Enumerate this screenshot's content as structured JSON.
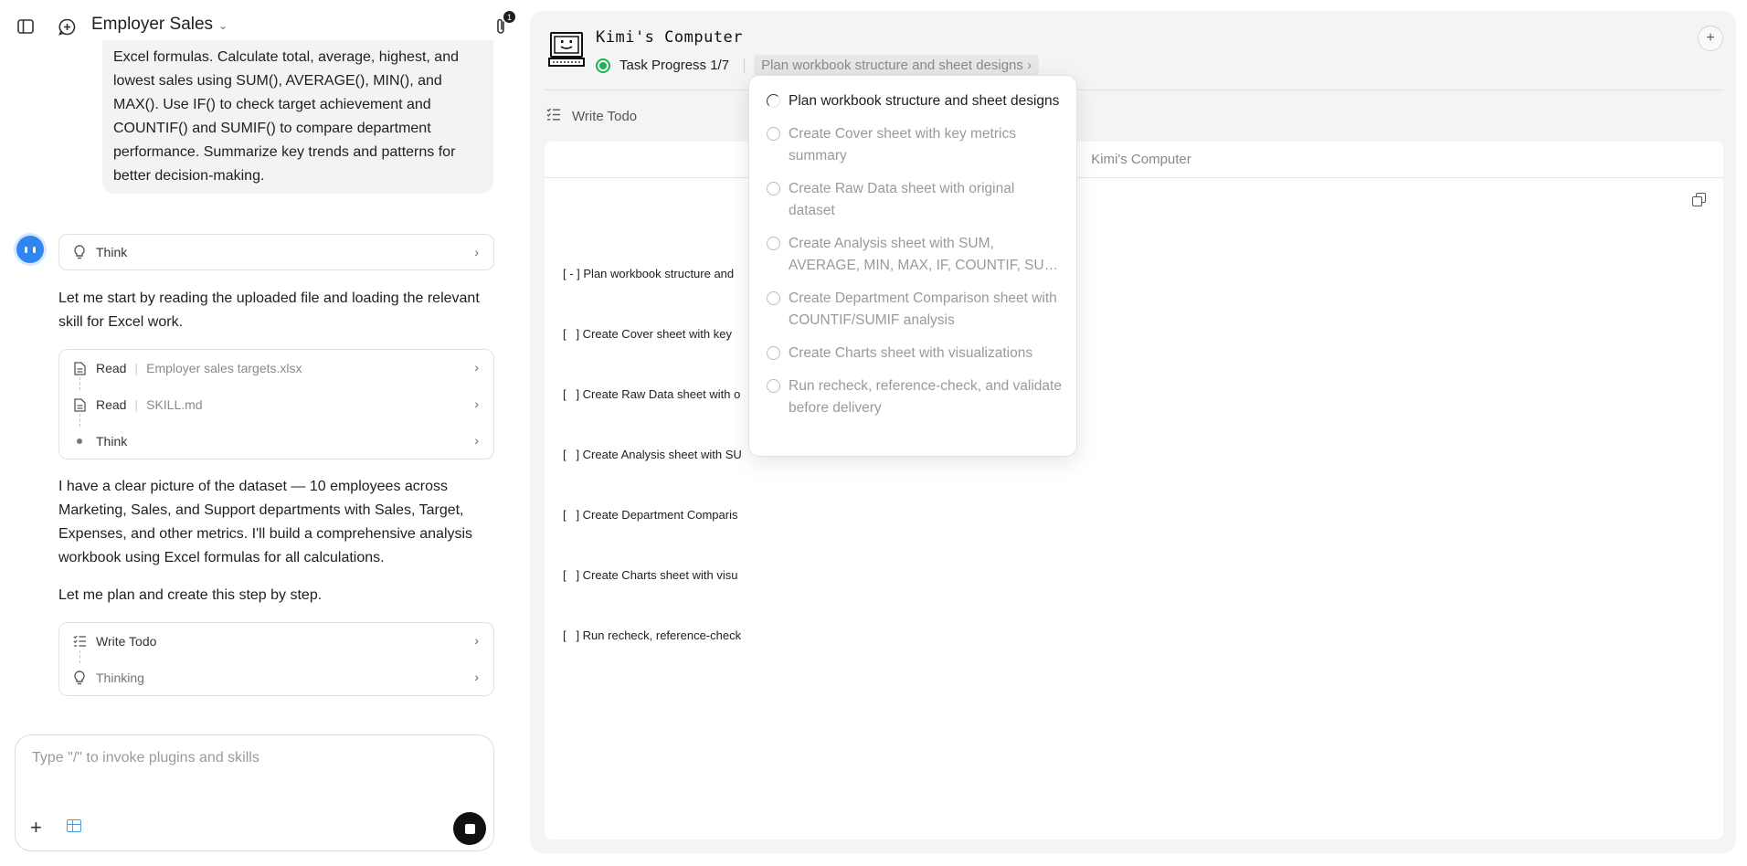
{
  "header": {
    "title": "Employer Sales",
    "attachment_count": "1"
  },
  "chat": {
    "user_message": "Excel formulas. Calculate total, average, highest, and lowest sales using SUM(), AVERAGE(), MIN(), and MAX(). Use IF() to check target achievement and COUNTIF() and SUMIF() to compare department performance. Summarize key trends and patterns for better decision-making.",
    "think_label": "Think",
    "msg1": "Let me start by reading the uploaded file and loading the relevant skill for Excel work.",
    "tool_group1": [
      {
        "name": "Read",
        "arg": "Employer sales targets.xlsx"
      },
      {
        "name": "Read",
        "arg": "SKILL.md"
      },
      {
        "name": "Think",
        "arg": ""
      }
    ],
    "msg2": "I have a clear picture of the dataset — 10 employees across Marketing, Sales, and Support departments with Sales, Target, Expenses, and other metrics. I'll build a comprehensive analysis workbook using Excel formulas for all calculations.",
    "msg3": "Let me plan and create this step by step.",
    "tool_group2": [
      {
        "name": "Write Todo"
      },
      {
        "name": "Thinking"
      }
    ]
  },
  "composer": {
    "placeholder": "Type \"/\" to invoke plugins and skills"
  },
  "computer": {
    "title": "Kimi's Computer",
    "progress_label": "Task Progress 1/7",
    "current_step": "Plan workbook structure and sheet designs",
    "tool_label": "Write Todo",
    "doc_title": "Kimi's Computer",
    "todo_lines": [
      "[ - ] Plan workbook structure and",
      "[   ] Create Cover sheet with key",
      "[   ] Create Raw Data sheet with o",
      "[   ] Create Analysis sheet with SU",
      "[   ] Create Department Comparis",
      "[   ] Create Charts sheet with visu",
      "[   ] Run recheck, reference-check"
    ]
  },
  "dropdown": {
    "items": [
      {
        "label": "Plan workbook structure and sheet designs",
        "status": "in_progress"
      },
      {
        "label": "Create Cover sheet with key metrics summary",
        "status": "pending"
      },
      {
        "label": "Create Raw Data sheet with original dataset",
        "status": "pending"
      },
      {
        "label": "Create Analysis sheet with SUM, AVERAGE, MIN, MAX, IF, COUNTIF, SUMIF",
        "status": "pending",
        "line1": "Create Analysis sheet with SUM,",
        "line2": "AVERAGE, MIN, MAX, IF, COUNTIF, SUMI..."
      },
      {
        "label": "Create Department Comparison sheet with COUNTIF/SUMIF analysis",
        "status": "pending"
      },
      {
        "label": "Create Charts sheet with visualizations",
        "status": "pending"
      },
      {
        "label": "Run recheck, reference-check, and validate before delivery",
        "status": "pending"
      }
    ]
  },
  "colors": {
    "accent_blue": "#2f86f0",
    "progress_green": "#1fb25a"
  }
}
